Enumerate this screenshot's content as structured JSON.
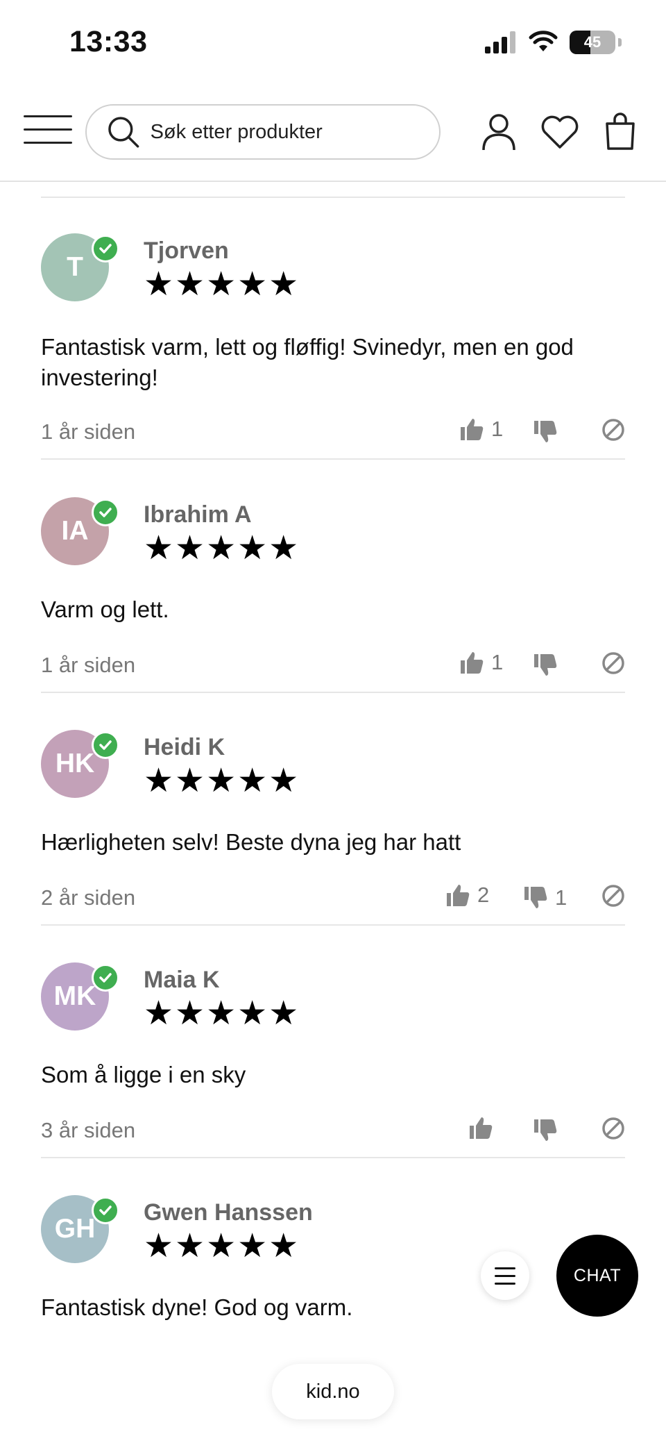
{
  "status_bar": {
    "time": "13:33",
    "battery": "45",
    "battery_level": 0.45
  },
  "header": {
    "search_placeholder": "Søk etter produkter"
  },
  "reviews": [
    {
      "initials": "T",
      "avatar_color": "#a3c4b5",
      "name": "Tjorven",
      "stars": "★★★★★",
      "body": "Fantastisk varm, lett og fløffig! Svinedyr, men en god investering!",
      "age": "1 år siden",
      "up": "1",
      "down": ""
    },
    {
      "initials": "IA",
      "avatar_color": "#c4a2a9",
      "name": "Ibrahim A",
      "stars": "★★★★★",
      "body": "Varm og lett.",
      "age": "1 år siden",
      "up": "1",
      "down": ""
    },
    {
      "initials": "HK",
      "avatar_color": "#c3a1b8",
      "name": "Heidi K",
      "stars": "★★★★★",
      "body": "Hærligheten selv! Beste dyna jeg har hatt",
      "age": "2 år siden",
      "up": "2",
      "down": "1"
    },
    {
      "initials": "MK",
      "avatar_color": "#bda5c9",
      "name": "Maia K",
      "stars": "★★★★★",
      "body": "Som å ligge i en sky",
      "age": "3 år siden",
      "up": "",
      "down": ""
    },
    {
      "initials": "GH",
      "avatar_color": "#a6bfc7",
      "name": "Gwen Hanssen",
      "stars": "★★★★★",
      "body": "Fantastisk dyne! God og varm.",
      "age": "",
      "up": "",
      "down": ""
    }
  ],
  "chat": {
    "label": "CHAT"
  },
  "browser": {
    "url": "kid.no"
  },
  "colors": {
    "verified": "#3fae50",
    "divider": "#e6e6e6"
  }
}
